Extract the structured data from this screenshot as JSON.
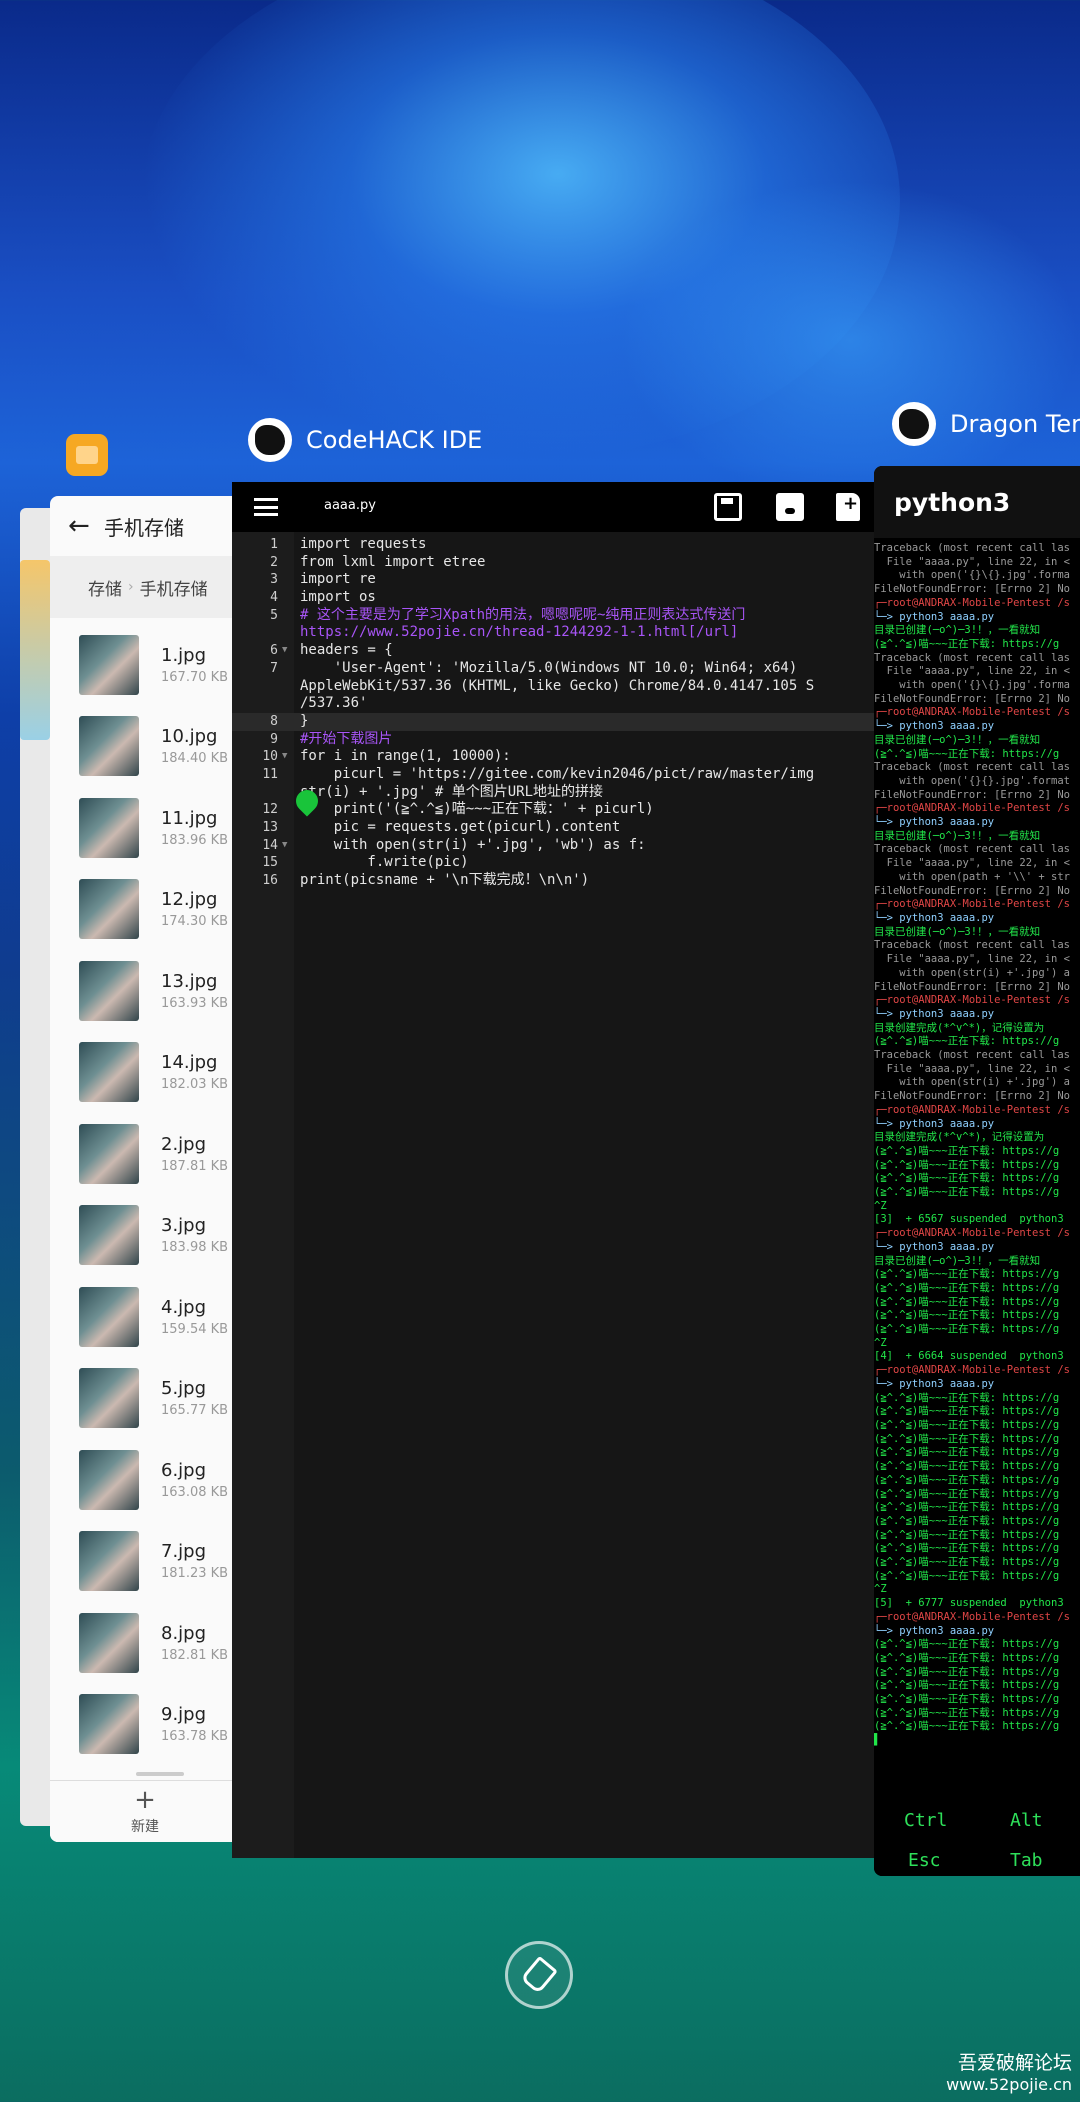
{
  "files_app": {
    "title": "手机存储",
    "breadcrumb": [
      "存储",
      "手机存储"
    ],
    "breadcrumb_sep": "›",
    "files": [
      {
        "name": "1.jpg",
        "size": "167.70 KB"
      },
      {
        "name": "10.jpg",
        "size": "184.40 KB"
      },
      {
        "name": "11.jpg",
        "size": "183.96 KB"
      },
      {
        "name": "12.jpg",
        "size": "174.30 KB"
      },
      {
        "name": "13.jpg",
        "size": "163.93 KB"
      },
      {
        "name": "14.jpg",
        "size": "182.03 KB"
      },
      {
        "name": "2.jpg",
        "size": "187.81 KB"
      },
      {
        "name": "3.jpg",
        "size": "183.98 KB"
      },
      {
        "name": "4.jpg",
        "size": "159.54 KB"
      },
      {
        "name": "5.jpg",
        "size": "165.77 KB"
      },
      {
        "name": "6.jpg",
        "size": "163.08 KB"
      },
      {
        "name": "7.jpg",
        "size": "181.23 KB"
      },
      {
        "name": "8.jpg",
        "size": "182.81 KB"
      },
      {
        "name": "9.jpg",
        "size": "163.78 KB"
      }
    ],
    "new_plus": "+",
    "new_label": "新建"
  },
  "ide": {
    "app_name": "CodeHACK IDE",
    "filename": "aaaa.py",
    "code": [
      {
        "ln": "1",
        "text": "import requests"
      },
      {
        "ln": "2",
        "text": "from lxml import etree"
      },
      {
        "ln": "3",
        "text": "import re"
      },
      {
        "ln": "4",
        "text": "import os"
      },
      {
        "ln": "5",
        "text": "# 这个主要是为了学习Xpath的用法，嗯嗯呢呢~纯用正则表达式传送门"
      },
      {
        "ln": "",
        "text": "https://www.52pojie.cn/thread-1244292-1-1.html[/url]"
      },
      {
        "ln": "6",
        "text": "headers = {"
      },
      {
        "ln": "7",
        "text": "    'User-Agent': 'Mozilla/5.0(Windows NT 10.0; Win64; x64)"
      },
      {
        "ln": "",
        "text": "AppleWebKit/537.36 (KHTML, like Gecko) Chrome/84.0.4147.105 S"
      },
      {
        "ln": "",
        "text": "/537.36'"
      },
      {
        "ln": "8",
        "text": "}"
      },
      {
        "ln": "9",
        "text": "#开始下载图片"
      },
      {
        "ln": "10",
        "text": "for i in range(1, 10000):"
      },
      {
        "ln": "11",
        "text": "    picurl = 'https://gitee.com/kevin2046/pict/raw/master/img"
      },
      {
        "ln": "",
        "text": "str(i) + '.jpg' # 单个图片URL地址的拼接"
      },
      {
        "ln": "12",
        "text": "    print('(≧^.^≦)喵~~~正在下载：' + picurl)"
      },
      {
        "ln": "13",
        "text": "    pic = requests.get(picurl).content"
      },
      {
        "ln": "14",
        "text": "    with open(str(i) +'.jpg', 'wb') as f:"
      },
      {
        "ln": "15",
        "text": "        f.write(pic)"
      },
      {
        "ln": "16",
        "text": "print(picsname + '\\n下载完成！\\n\\n')"
      }
    ]
  },
  "terminal": {
    "app_name": "Dragon Ter",
    "title": "python3",
    "lines": [
      "Traceback (most recent call las",
      "  File \"aaaa.py\", line 22, in <",
      "    with open('{}\\{}.jpg'.forma",
      "FileNotFoundError: [Errno 2] No",
      "┌─root@ANDRAX-Mobile-Pentest /s",
      "└─> python3 aaaa.py",
      "目录已创建(─o^)─3!！，一看就知",
      "(≧^.^≦)喵~~~正在下载: https://g",
      "Traceback (most recent call las",
      "  File \"aaaa.py\", line 22, in <",
      "    with open('{}\\{}.jpg'.forma",
      "FileNotFoundError: [Errno 2] No",
      "┌─root@ANDRAX-Mobile-Pentest /s",
      "└─> python3 aaaa.py",
      "目录已创建(─o^)─3!！，一看就知",
      "(≧^.^≦)喵~~~正在下载: https://g",
      "Traceback (most recent call las",
      "    with open('{}{}.jpg'.format",
      "FileNotFoundError: [Errno 2] No",
      "┌─root@ANDRAX-Mobile-Pentest /s",
      "└─> python3 aaaa.py",
      "目录已创建(─o^)─3!！，一看就知",
      "Traceback (most recent call las",
      "  File \"aaaa.py\", line 22, in <",
      "    with open(path + '\\\\' + str",
      "FileNotFoundError: [Errno 2] No",
      "┌─root@ANDRAX-Mobile-Pentest /s",
      "└─> python3 aaaa.py",
      "目录已创建(─o^)─3!！，一看就知",
      "Traceback (most recent call las",
      "  File \"aaaa.py\", line 22, in <",
      "    with open(str(i) +'.jpg') a",
      "FileNotFoundError: [Errno 2] No",
      "┌─root@ANDRAX-Mobile-Pentest /s",
      "└─> python3 aaaa.py",
      "目录创建完成(*^v^*)，记得设置为",
      "(≧^.^≦)喵~~~正在下载: https://g",
      "Traceback (most recent call las",
      "  File \"aaaa.py\", line 22, in <",
      "    with open(str(i) +'.jpg') a",
      "FileNotFoundError: [Errno 2] No",
      "┌─root@ANDRAX-Mobile-Pentest /s",
      "└─> python3 aaaa.py",
      "目录创建完成(*^v^*)，记得设置为",
      "(≧^.^≦)喵~~~正在下载: https://g",
      "(≧^.^≦)喵~~~正在下载: https://g",
      "(≧^.^≦)喵~~~正在下载: https://g",
      "(≧^.^≦)喵~~~正在下载: https://g",
      "^Z",
      "[3]  + 6567 suspended  python3",
      "┌─root@ANDRAX-Mobile-Pentest /s",
      "└─> python3 aaaa.py",
      "目录已创建(─o^)─3!！，一看就知",
      "(≧^.^≦)喵~~~正在下载: https://g",
      "(≧^.^≦)喵~~~正在下载: https://g",
      "(≧^.^≦)喵~~~正在下载: https://g",
      "(≧^.^≦)喵~~~正在下载: https://g",
      "(≧^.^≦)喵~~~正在下载: https://g",
      "^Z",
      "[4]  + 6664 suspended  python3",
      "┌─root@ANDRAX-Mobile-Pentest /s",
      "└─> python3 aaaa.py",
      "(≧^.^≦)喵~~~正在下载: https://g",
      "(≧^.^≦)喵~~~正在下载: https://g",
      "(≧^.^≦)喵~~~正在下载: https://g",
      "(≧^.^≦)喵~~~正在下载: https://g",
      "(≧^.^≦)喵~~~正在下载: https://g",
      "(≧^.^≦)喵~~~正在下载: https://g",
      "(≧^.^≦)喵~~~正在下载: https://g",
      "(≧^.^≦)喵~~~正在下载: https://g",
      "(≧^.^≦)喵~~~正在下载: https://g",
      "(≧^.^≦)喵~~~正在下载: https://g",
      "(≧^.^≦)喵~~~正在下载: https://g",
      "(≧^.^≦)喵~~~正在下载: https://g",
      "(≧^.^≦)喵~~~正在下载: https://g",
      "(≧^.^≦)喵~~~正在下载: https://g",
      "^Z",
      "[5]  + 6777 suspended  python3",
      "┌─root@ANDRAX-Mobile-Pentest /s",
      "└─> python3 aaaa.py",
      "(≧^.^≦)喵~~~正在下载: https://g",
      "(≧^.^≦)喵~~~正在下载: https://g",
      "(≧^.^≦)喵~~~正在下载: https://g",
      "(≧^.^≦)喵~~~正在下载: https://g",
      "(≧^.^≦)喵~~~正在下载: https://g",
      "(≧^.^≦)喵~~~正在下载: https://g",
      "(≧^.^≦)喵~~~正在下载: https://g",
      "▌"
    ],
    "keys": {
      "ctrl": "Ctrl",
      "alt": "Alt",
      "esc": "Esc",
      "tab": "Tab"
    }
  },
  "watermark": {
    "line1": "吾爱破解论坛",
    "line2": "www.52pojie.cn"
  }
}
